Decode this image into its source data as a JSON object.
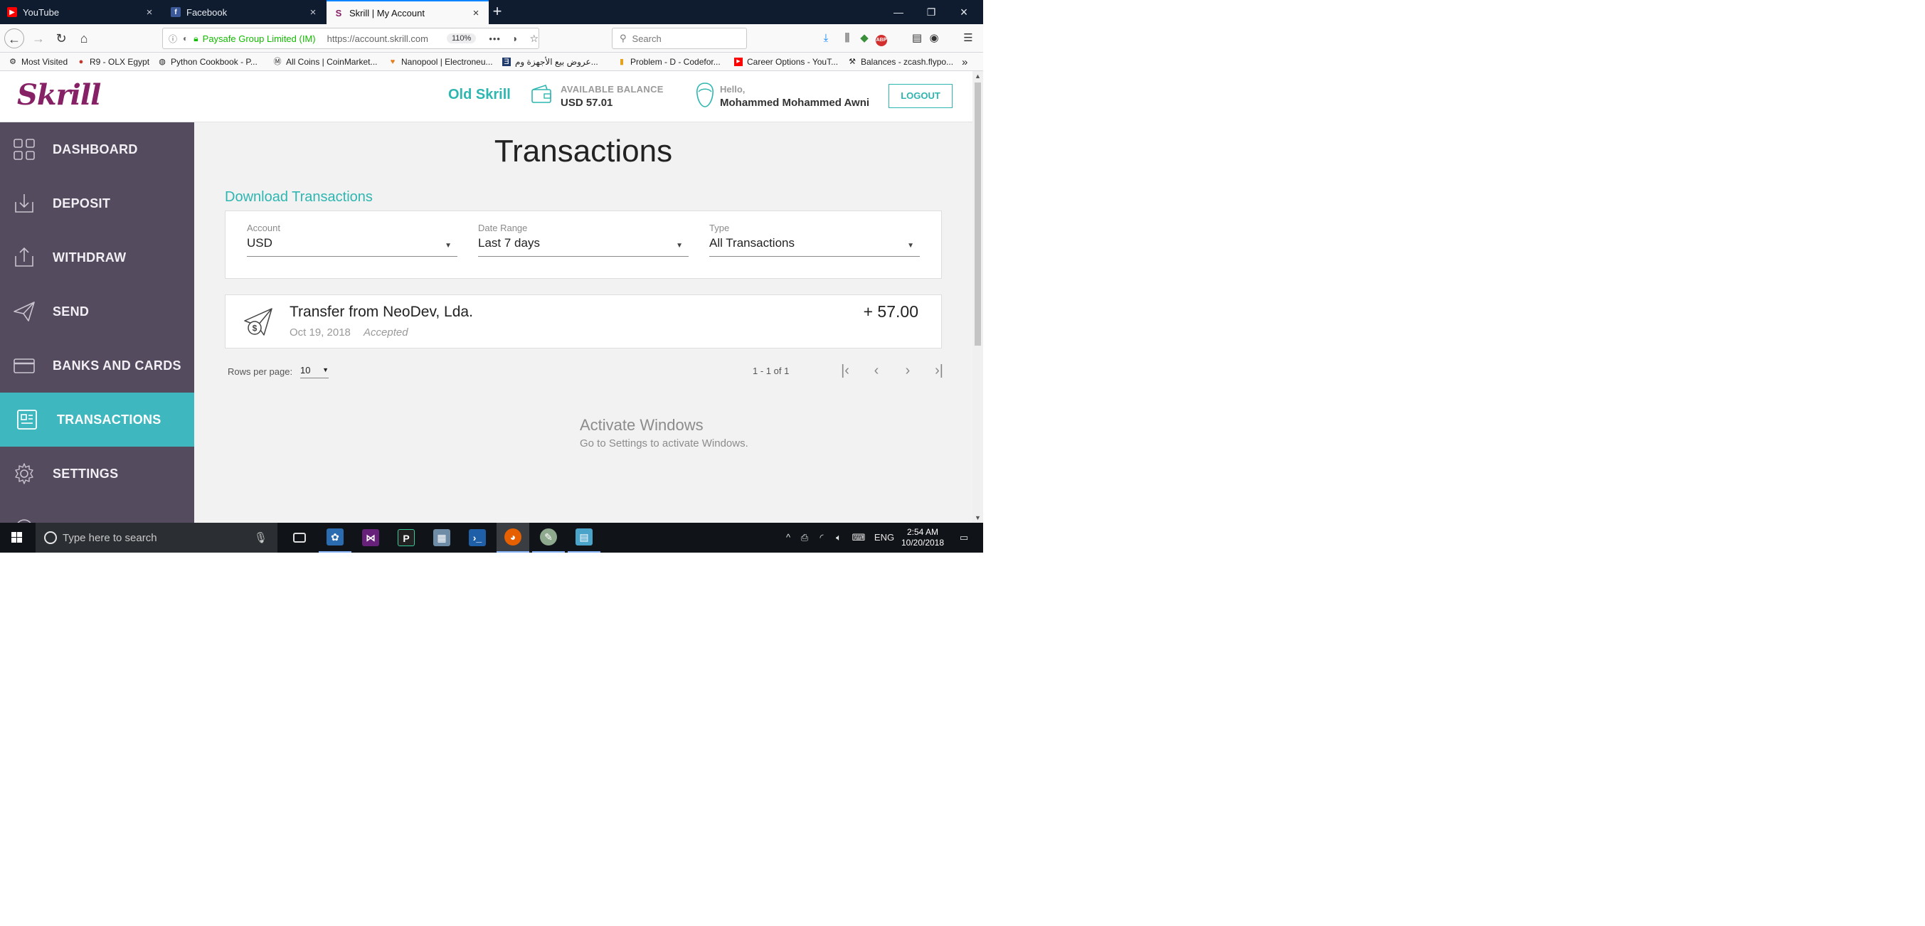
{
  "browser": {
    "tabs": [
      {
        "label": "YouTube",
        "favicon": "youtube-icon",
        "color": "#ff0000",
        "active": false
      },
      {
        "label": "Facebook",
        "favicon": "facebook-icon",
        "color": "#3b5998",
        "active": false
      },
      {
        "label": "Skrill | My Account",
        "favicon": "skrill-icon",
        "color": "#862165",
        "active": true
      }
    ],
    "site_identity": "Paysafe Group Limited (IM)",
    "url": "https://account.skrill.com",
    "zoom": "110%",
    "search_placeholder": "Search",
    "bookmarks": [
      {
        "label": "Most Visited",
        "icon": "gear-icon"
      },
      {
        "label": "R9 - OLX Egypt",
        "icon": "olx-icon"
      },
      {
        "label": "Python Cookbook - P...",
        "icon": "globe-icon"
      },
      {
        "label": "All Coins | CoinMarket...",
        "icon": "coinmarketcap-icon"
      },
      {
        "label": "Nanopool | Electroneu...",
        "icon": "nanopool-icon"
      },
      {
        "label": "عروض بيع الأجهزة وم...",
        "icon": "bookmark-icon"
      },
      {
        "label": "Problem - D - Codefor...",
        "icon": "codeforces-icon"
      },
      {
        "label": "Career Options - YouT...",
        "icon": "youtube-icon"
      },
      {
        "label": "Balances - zcash.flypo...",
        "icon": "pickaxe-icon"
      }
    ]
  },
  "skrill": {
    "logo": "Skrill",
    "old_skrill": "Old Skrill",
    "balance_label": "AVAILABLE BALANCE",
    "balance_value": "USD 57.01",
    "hello": "Hello,",
    "user_name": "Mohammed Mohammed Awni",
    "logout": "LOGOUT",
    "sidebar": [
      {
        "label": "DASHBOARD",
        "icon": "dashboard-grid-icon",
        "active": false
      },
      {
        "label": "DEPOSIT",
        "icon": "deposit-icon",
        "active": false
      },
      {
        "label": "WITHDRAW",
        "icon": "withdraw-icon",
        "active": false
      },
      {
        "label": "SEND",
        "icon": "send-plane-icon",
        "active": false
      },
      {
        "label": "BANKS AND CARDS",
        "icon": "card-icon",
        "active": false
      },
      {
        "label": "TRANSACTIONS",
        "icon": "transactions-icon",
        "active": true
      },
      {
        "label": "SETTINGS",
        "icon": "settings-gear-icon",
        "active": false
      }
    ],
    "page_title": "Transactions",
    "download_link": "Download Transactions",
    "filters": {
      "account_label": "Account",
      "account_value": "USD",
      "date_label": "Date Range",
      "date_value": "Last 7 days",
      "type_label": "Type",
      "type_value": "All Transactions"
    },
    "transaction": {
      "description": "Transfer from NeoDev, Lda.",
      "date": "Oct 19, 2018",
      "status": "Accepted",
      "amount": "+ 57.00"
    },
    "pagination": {
      "rows_label": "Rows per page:",
      "rows_value": "10",
      "range": "1 - 1 of 1"
    },
    "accent_color": "#2eb6b1",
    "sidebar_color": "#544c5e"
  },
  "watermark": {
    "title": "Activate Windows",
    "subtitle": "Go to Settings to activate Windows."
  },
  "taskbar": {
    "search_placeholder": "Type here to search",
    "language": "ENG",
    "time": "2:54 AM",
    "date": "10/20/2018"
  }
}
